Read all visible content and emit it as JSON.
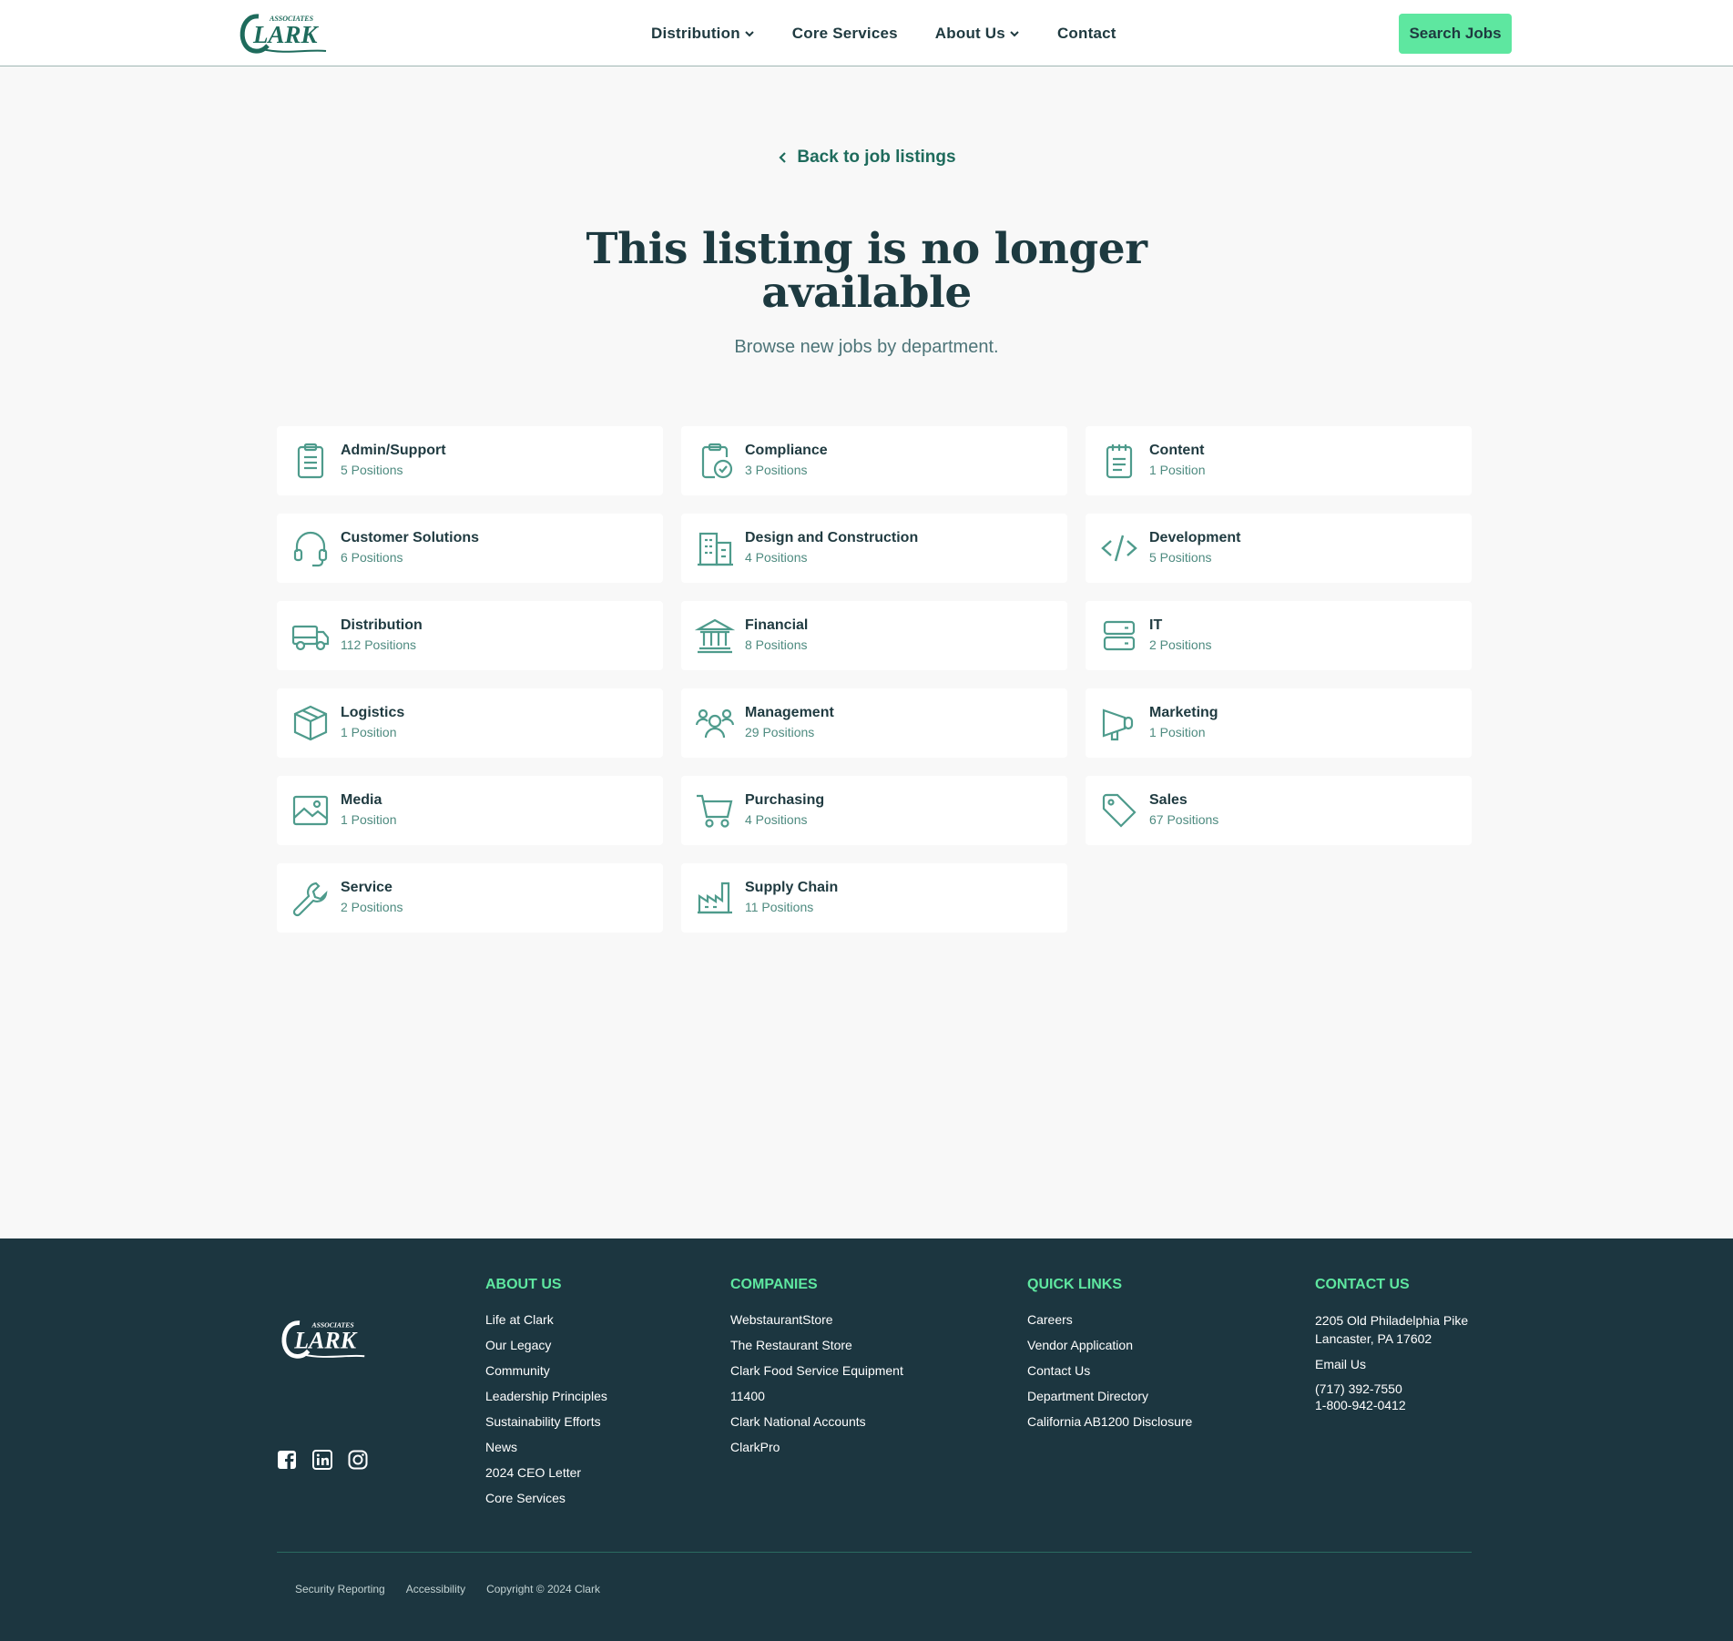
{
  "header": {
    "logo_text": "CLARK",
    "logo_subtext": "ASSOCIATES",
    "nav": [
      {
        "label": "Distribution",
        "has_dropdown": true
      },
      {
        "label": "Core Services",
        "has_dropdown": false
      },
      {
        "label": "About Us",
        "has_dropdown": true
      },
      {
        "label": "Contact",
        "has_dropdown": false
      }
    ],
    "search_button": "Search Jobs"
  },
  "main": {
    "back_link": "Back to job listings",
    "title_line1": "This listing is no longer",
    "title_line2": "available",
    "subtitle": "Browse new jobs by department."
  },
  "departments": [
    {
      "name": "Admin/Support",
      "positions": "5 Positions",
      "icon": "clipboard-icon"
    },
    {
      "name": "Compliance",
      "positions": "3 Positions",
      "icon": "clipboard-check-icon"
    },
    {
      "name": "Content",
      "positions": "1 Position",
      "icon": "notepad-icon"
    },
    {
      "name": "Customer Solutions",
      "positions": "6 Positions",
      "icon": "headset-icon"
    },
    {
      "name": "Design and Construction",
      "positions": "4 Positions",
      "icon": "buildings-icon"
    },
    {
      "name": "Development",
      "positions": "5 Positions",
      "icon": "code-icon"
    },
    {
      "name": "Distribution",
      "positions": "112 Positions",
      "icon": "truck-icon"
    },
    {
      "name": "Financial",
      "positions": "8 Positions",
      "icon": "bank-icon"
    },
    {
      "name": "IT",
      "positions": "2 Positions",
      "icon": "server-icon"
    },
    {
      "name": "Logistics",
      "positions": "1 Position",
      "icon": "box-icon"
    },
    {
      "name": "Management",
      "positions": "29 Positions",
      "icon": "people-icon"
    },
    {
      "name": "Marketing",
      "positions": "1 Position",
      "icon": "megaphone-icon"
    },
    {
      "name": "Media",
      "positions": "1 Position",
      "icon": "image-icon"
    },
    {
      "name": "Purchasing",
      "positions": "4 Positions",
      "icon": "cart-icon"
    },
    {
      "name": "Sales",
      "positions": "67 Positions",
      "icon": "tag-icon"
    },
    {
      "name": "Service",
      "positions": "2 Positions",
      "icon": "wrench-icon"
    },
    {
      "name": "Supply Chain",
      "positions": "11 Positions",
      "icon": "factory-icon"
    }
  ],
  "footer": {
    "about": {
      "heading": "ABOUT US",
      "links": [
        "Life at Clark",
        "Our Legacy",
        "Community",
        "Leadership Principles",
        "Sustainability Efforts",
        "News",
        "2024 CEO Letter",
        "Core Services"
      ]
    },
    "companies": {
      "heading": "COMPANIES",
      "links": [
        "WebstaurantStore",
        "The Restaurant Store",
        "Clark Food Service Equipment",
        "11400",
        "Clark National Accounts",
        "ClarkPro"
      ]
    },
    "quick": {
      "heading": "QUICK LINKS",
      "links": [
        "Careers",
        "Vendor Application",
        "Contact Us",
        "Department Directory",
        "California AB1200 Disclosure"
      ]
    },
    "contact": {
      "heading": "CONTACT US",
      "address1": "2205 Old Philadelphia Pike",
      "address2": "Lancaster, PA 17602",
      "email": "Email Us",
      "phone1": "(717) 392-7550",
      "phone2": "1-800-942-0412"
    },
    "bottom": [
      "Security Reporting",
      "Accessibility",
      "Copyright © 2024 Clark"
    ],
    "socials": [
      "facebook-icon",
      "linkedin-icon",
      "instagram-icon"
    ]
  },
  "colors": {
    "brand_green": "#1e6b5c",
    "accent_mint": "#5ee7a0",
    "icon_teal": "#4e9b8c",
    "footer_bg": "#1c3640",
    "page_bg": "#f8f8f8"
  }
}
